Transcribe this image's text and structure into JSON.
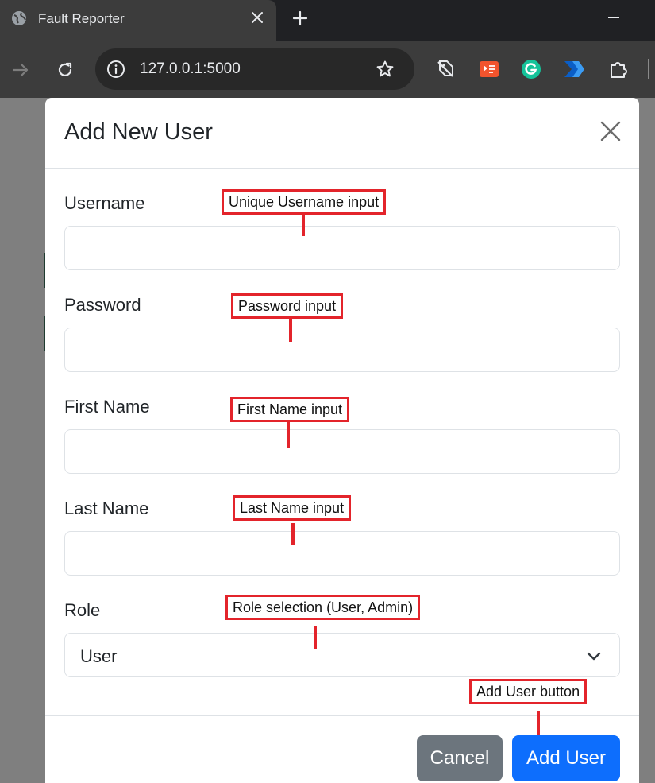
{
  "browser": {
    "tab_title": "Fault Reporter",
    "url": "127.0.0.1:5000"
  },
  "modal": {
    "title": "Add New User",
    "fields": [
      {
        "label": "Username",
        "value": ""
      },
      {
        "label": "Password",
        "value": ""
      },
      {
        "label": "First Name",
        "value": ""
      },
      {
        "label": "Last Name",
        "value": ""
      }
    ],
    "role": {
      "label": "Role",
      "selected": "User"
    },
    "cancel_label": "Cancel",
    "submit_label": "Add User"
  },
  "annotations": [
    "Unique Username input",
    "Password input",
    "First Name input",
    "Last Name input",
    "Role selection (User, Admin)",
    "Add User button"
  ],
  "colors": {
    "primary": "#0d6efd",
    "secondary": "#6c757d",
    "annotation": "#e3242b"
  }
}
